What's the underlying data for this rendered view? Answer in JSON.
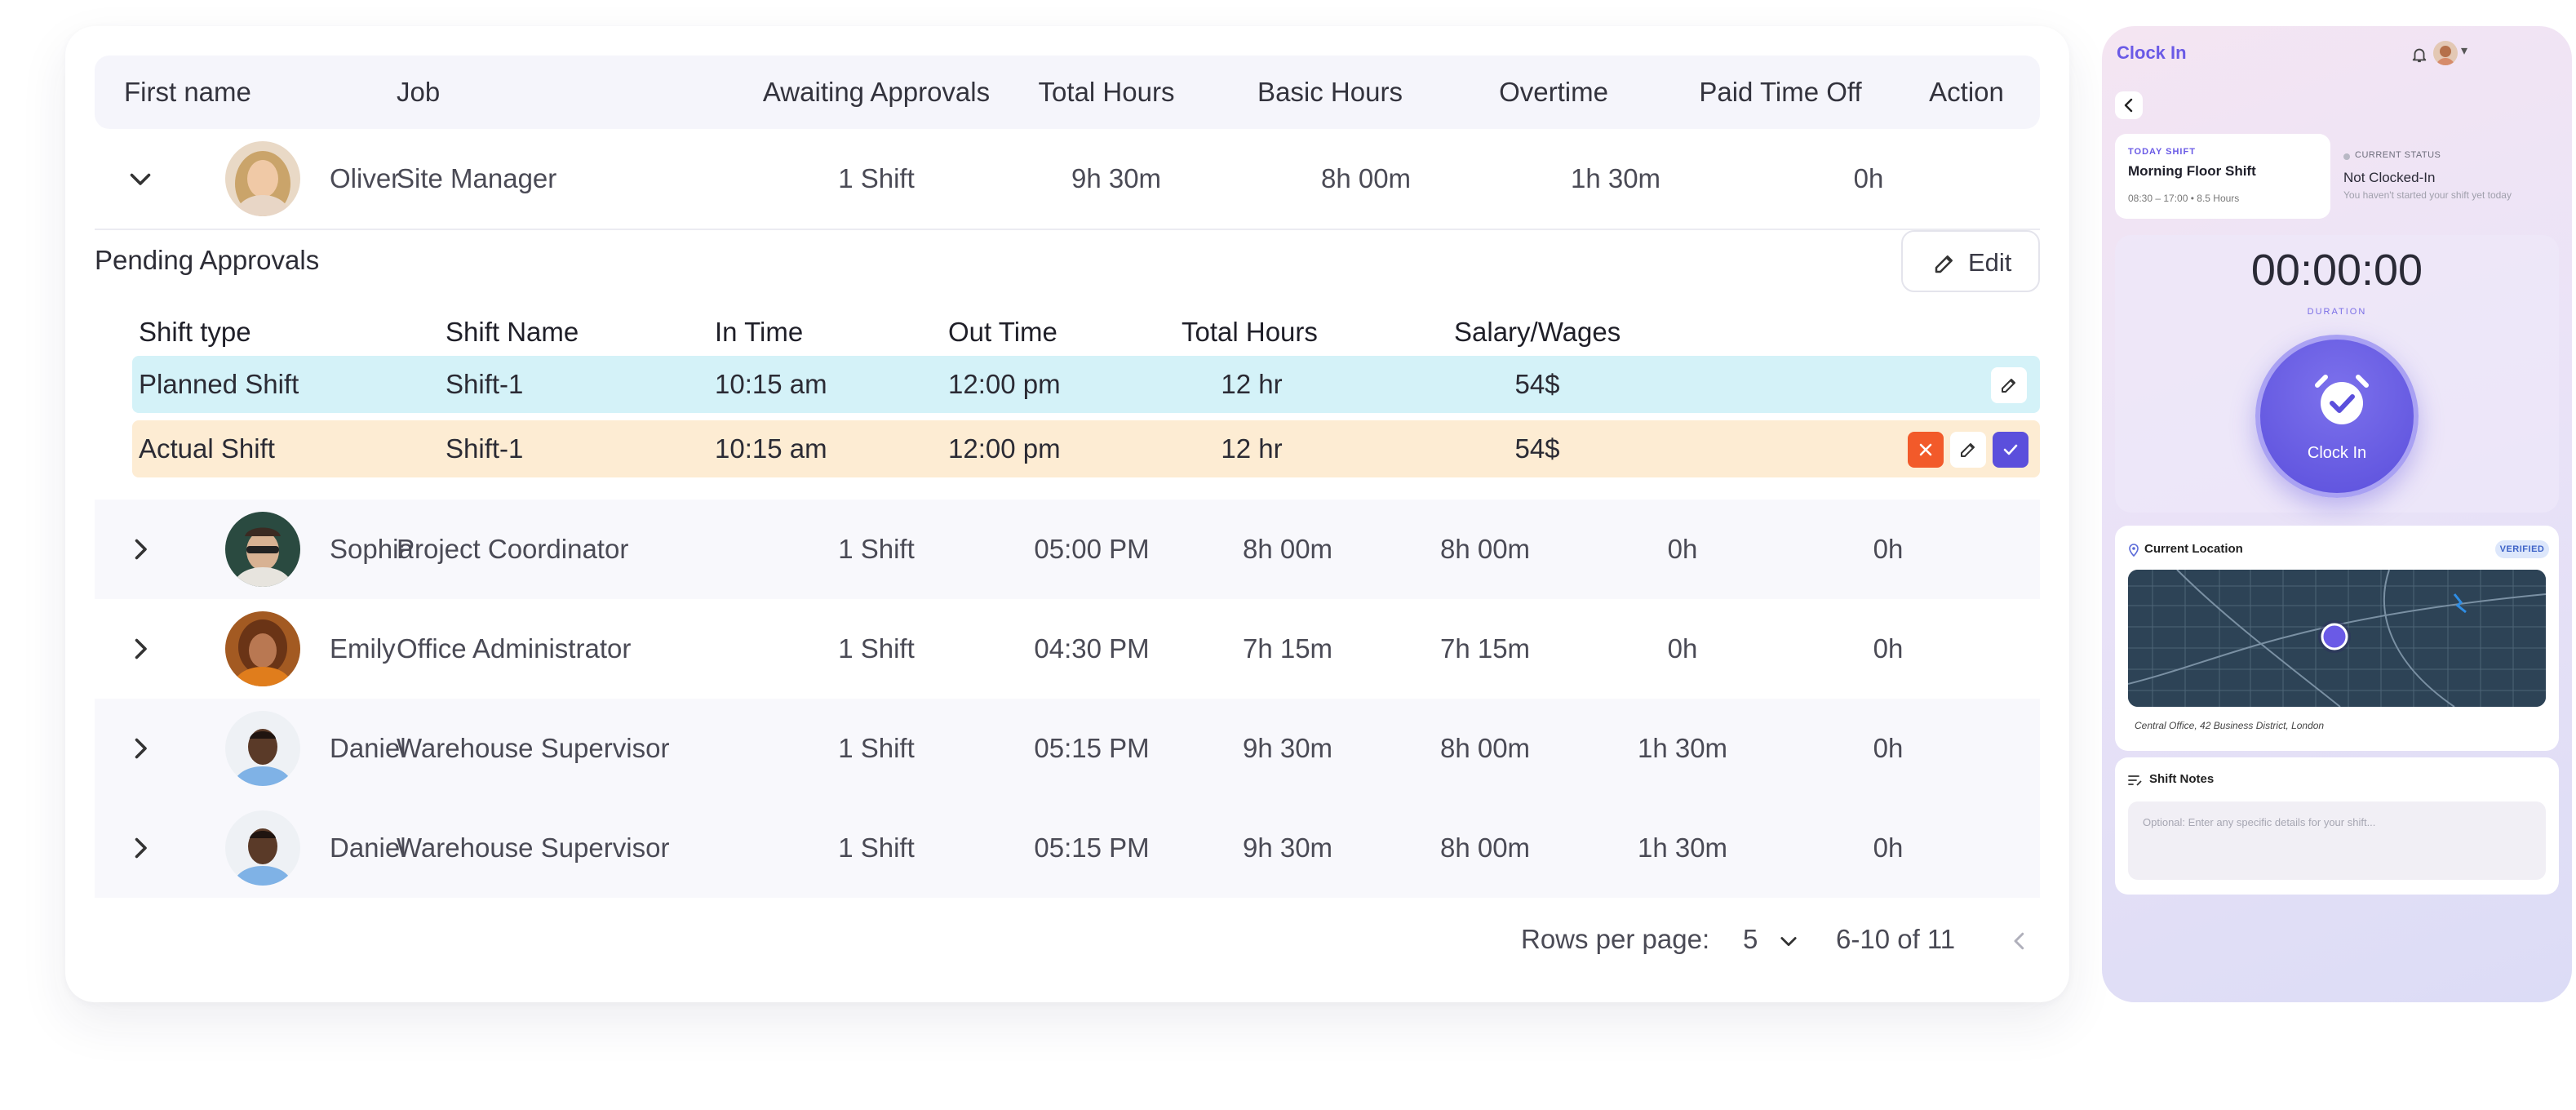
{
  "table": {
    "headers": {
      "first_name": "First name",
      "job": "Job",
      "awaiting": "Awaiting Approvals",
      "total_hours": "Total Hours",
      "basic_hours": "Basic Hours",
      "overtime": "Overtime",
      "pto": "Paid Time Off",
      "action": "Action"
    },
    "expanded_row": {
      "first_name": "Oliver",
      "job": "Site Manager",
      "awaiting": "1 Shift",
      "total_hours": "9h 30m",
      "basic_hours": "8h 00m",
      "overtime": "1h 30m",
      "pto": "0h"
    },
    "rows": [
      {
        "first_name": "Sophia",
        "job": "Project Coordinator",
        "awaiting": "1 Shift",
        "c4": "05:00 PM",
        "c5": "8h 00m",
        "c6": "8h 00m",
        "c7": "0h",
        "c8": "0h"
      },
      {
        "first_name": "Emily",
        "job": "Office Administrator",
        "awaiting": "1 Shift",
        "c4": "04:30 PM",
        "c5": "7h 15m",
        "c6": "7h 15m",
        "c7": "0h",
        "c8": "0h"
      },
      {
        "first_name": "Daniel",
        "job": "Warehouse Supervisor",
        "awaiting": "1 Shift",
        "c4": "05:15 PM",
        "c5": "9h 30m",
        "c6": "8h 00m",
        "c7": "1h 30m",
        "c8": "0h"
      },
      {
        "first_name": "Daniel",
        "job": "Warehouse Supervisor",
        "awaiting": "1 Shift",
        "c4": "05:15 PM",
        "c5": "9h 30m",
        "c6": "8h 00m",
        "c7": "1h 30m",
        "c8": "0h"
      }
    ]
  },
  "pending": {
    "title": "Pending Approvals",
    "edit_label": "Edit",
    "headers": {
      "shift_type": "Shift type",
      "shift_name": "Shift Name",
      "in_time": "In Time",
      "out_time": "Out Time",
      "total_hours": "Total Hours",
      "salary": "Salary/Wages"
    },
    "planned": {
      "shift_type": "Planned Shift",
      "shift_name": "Shift-1",
      "in_time": "10:15 am",
      "out_time": "12:00 pm",
      "total_hours": "12 hr",
      "salary": "54$"
    },
    "actual": {
      "shift_type": "Actual Shift",
      "shift_name": "Shift-1",
      "in_time": "10:15 am",
      "out_time": "12:00 pm",
      "total_hours": "12 hr",
      "salary": "54$"
    }
  },
  "pagination": {
    "rows_per_page_label": "Rows per page:",
    "rows_per_page_value": "5",
    "range": "6-10 of 11"
  },
  "phone": {
    "title": "Clock In",
    "today_eyebrow": "TODAY SHIFT",
    "shift_name": "Morning Floor Shift",
    "shift_time": "08:30 – 17:00 • 8.5 Hours",
    "status_eyebrow": "CURRENT STATUS",
    "status_value": "Not Clocked-In",
    "status_sub": "You haven't started your shift yet today",
    "timer": "00:00:00",
    "duration_label": "DURATION",
    "clock_label": "Clock In",
    "location_title": "Current Location",
    "verified": "VERIFIED",
    "address": "Central Office, 42 Business District, London",
    "notes_title": "Shift Notes",
    "notes_placeholder": "Optional: Enter any specific details for your shift..."
  },
  "colors": {
    "accent": "#5b4fdc",
    "planned_bg": "#d4f2f8",
    "actual_bg": "#fdecd3",
    "reject": "#f25a2a"
  }
}
